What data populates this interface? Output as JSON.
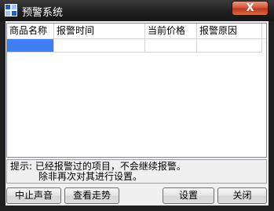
{
  "window": {
    "title": "预警系统",
    "app_icon": "app-window-icon",
    "close_icon": "close-icon",
    "close_label": "X"
  },
  "table": {
    "columns": [
      "商品名称",
      "报警时间",
      "当前价格",
      "报警原因"
    ],
    "rows": [
      [
        "",
        "",
        "",
        ""
      ]
    ]
  },
  "hint": {
    "line1": "提示: 已经报警过的项目，不会继续报警。",
    "line2": "除非再次对其进行设置。"
  },
  "buttons": {
    "stop_sound": "中止声音",
    "view_trend": "查看走势",
    "settings": "设置",
    "close": "关闭"
  },
  "colors": {
    "selection": "#3d7ff0",
    "close_button": "#c7411f"
  }
}
